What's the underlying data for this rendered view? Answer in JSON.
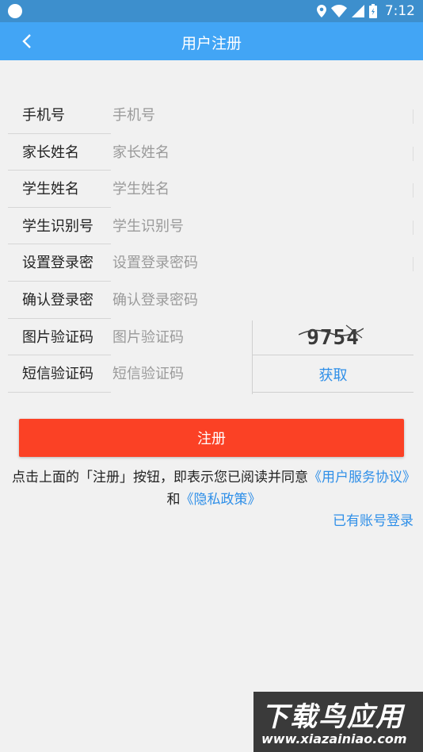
{
  "status_bar": {
    "time": "7:12",
    "icons": [
      "location-icon",
      "wifi-icon",
      "signal-icon",
      "battery-icon"
    ]
  },
  "app_bar": {
    "title": "用户注册",
    "back_icon": "chevron-left-icon"
  },
  "form": {
    "fields": [
      {
        "label": "手机号",
        "placeholder": "手机号"
      },
      {
        "label": "家长姓名",
        "placeholder": "家长姓名"
      },
      {
        "label": "学生姓名",
        "placeholder": "学生姓名"
      },
      {
        "label": "学生识别号",
        "placeholder": "学生识别号"
      },
      {
        "label": "设置登录密",
        "placeholder": "设置登录密码"
      },
      {
        "label": "确认登录密",
        "placeholder": "确认登录密码"
      },
      {
        "label": "图片验证码",
        "placeholder": "图片验证码"
      },
      {
        "label": "短信验证码",
        "placeholder": "短信验证码"
      }
    ],
    "captcha_text": "9754",
    "get_code_label": "获取"
  },
  "submit_label": "注册",
  "agreement": {
    "prefix": "点击上面的「注册」按钮，即表示您已阅读并同意",
    "user_agreement": "《用户服务协议》",
    "and": "和",
    "privacy_policy": "《隐私政策》"
  },
  "login_link": "已有账号登录",
  "watermark": {
    "title": "下载鸟应用",
    "url": "www.xiazainiao.com"
  },
  "colors": {
    "status_bar": "#3d8fcd",
    "app_bar": "#42a5f5",
    "submit": "#fb4125",
    "link": "#2f8fe8",
    "background": "#f1f1f1"
  }
}
